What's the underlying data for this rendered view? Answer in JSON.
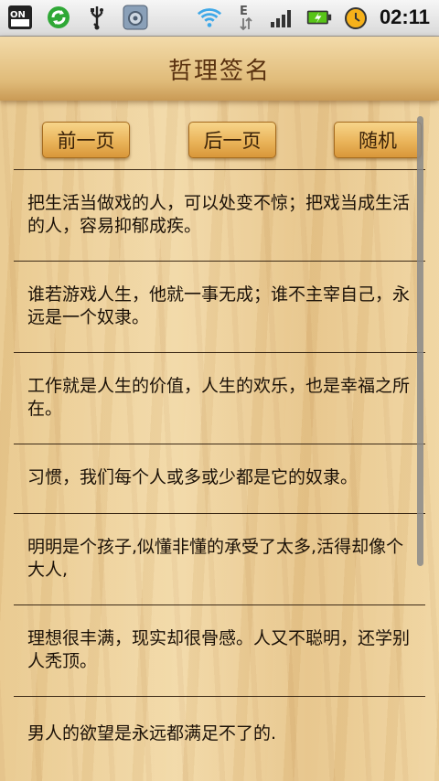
{
  "status_bar": {
    "time": "02:11",
    "icons": [
      "on-off-icon",
      "sync-icon",
      "usb-icon",
      "settings-app-icon",
      "wifi-icon",
      "edge-data-icon",
      "signal-icon",
      "battery-charging-icon",
      "alarm-icon"
    ],
    "left_label": "ON"
  },
  "header": {
    "title": "哲理签名"
  },
  "buttons": {
    "prev": "前一页",
    "next": "后一页",
    "random": "随机"
  },
  "quotes": [
    "把生活当做戏的人，可以处变不惊；把戏当成生活的人，容易抑郁成疾。",
    "谁若游戏人生，他就一事无成；谁不主宰自己，永远是一个奴隶。",
    "工作就是人生的价值，人生的欢乐，也是幸福之所在。",
    "习惯，我们每个人或多或少都是它的奴隶。",
    "明明是个孩子,似懂非懂的承受了太多,活得却像个大人,",
    "理想很丰满，现实却很骨感。人又不聪明，还学别人秃顶。",
    "男人的欲望是永远都满足不了的."
  ],
  "colors": {
    "accent_button": "#eab45a",
    "title_text": "#5a3210",
    "divider": "#3c2a17"
  }
}
